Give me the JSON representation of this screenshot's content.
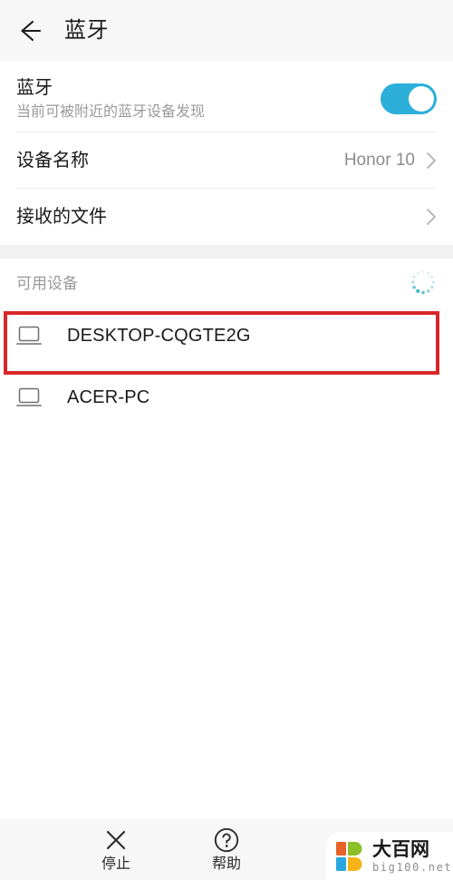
{
  "header": {
    "back_icon": "back-arrow-icon",
    "title": "蓝牙"
  },
  "settings": {
    "bluetooth": {
      "title": "蓝牙",
      "subtitle": "当前可被附近的蓝牙设备发现",
      "toggle_on": true,
      "toggle_color": "#2cafd9"
    },
    "device_name": {
      "title": "设备名称",
      "value": "Honor 10",
      "chevron_icon": "chevron-right-icon"
    },
    "received_files": {
      "title": "接收的文件",
      "value": "",
      "chevron_icon": "chevron-right-icon"
    }
  },
  "available": {
    "section_label": "可用设备",
    "spinner_icon": "loading-spinner-icon",
    "spinner_color": "#35aec4",
    "devices": [
      {
        "name": "DESKTOP-CQGTE2G",
        "icon": "laptop-icon",
        "highlighted": true
      },
      {
        "name": "ACER-PC",
        "icon": "laptop-icon",
        "highlighted": false
      }
    ],
    "highlight_color": "#d8272a"
  },
  "toolbar": {
    "items": [
      {
        "label": "停止",
        "icon": "close-x-icon"
      },
      {
        "label": "帮助",
        "icon": "question-circle-icon"
      },
      {
        "label": "",
        "icon": "more-options-icon"
      }
    ]
  },
  "watermark": {
    "cn_text": "大百网",
    "en_text": "big100.net",
    "logo_icon": "big100-logo-icon",
    "colors": {
      "orange": "#e8622a",
      "green": "#8cbf26",
      "blue": "#29a8e0",
      "yellow": "#f5b316"
    }
  }
}
